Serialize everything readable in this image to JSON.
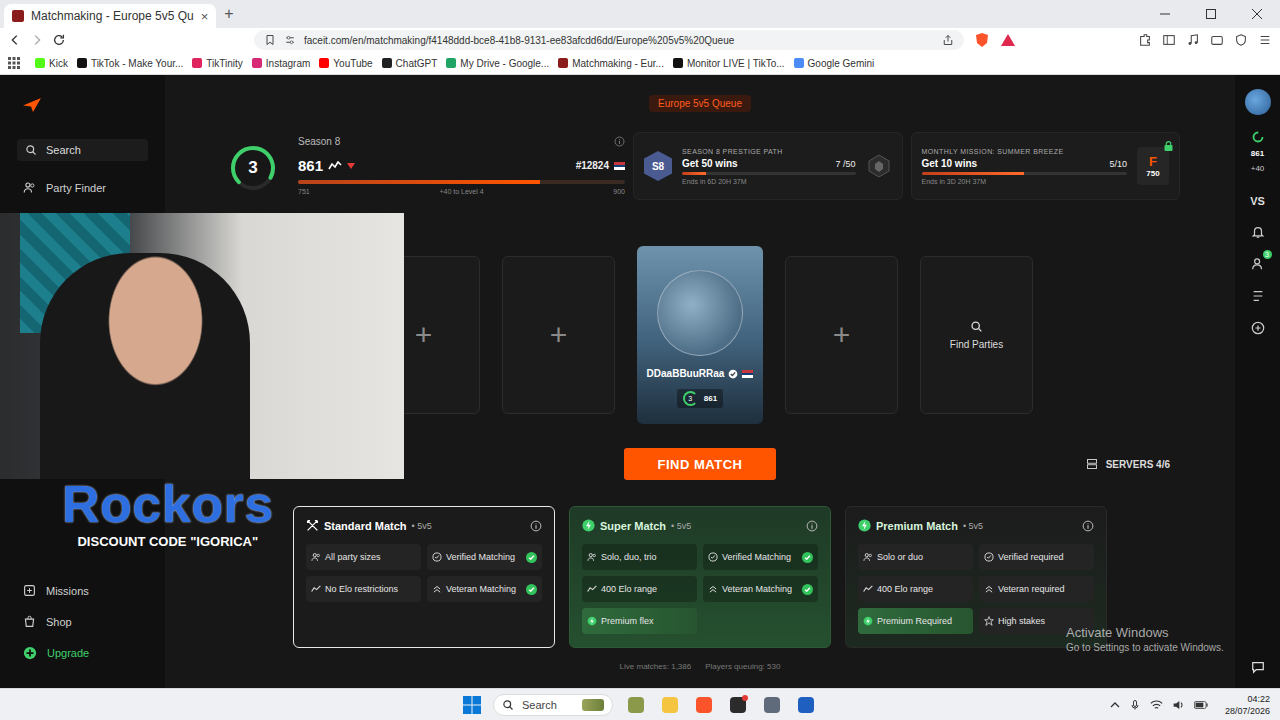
{
  "browser": {
    "tabs": [
      {
        "title": "Matchmaking - Europe 5v5 Qu",
        "selected": true,
        "close": "×"
      }
    ],
    "new_tab": "+",
    "url": "faceit.com/en/matchmaking/f4148ddd-bce8-41b8-9131-ee83afcdd6dd/Europe%205v5%20Queue",
    "bookmarks": [
      {
        "label": "Kick",
        "color": "#53fc18"
      },
      {
        "label": "TikTok - Make Your...",
        "color": "#111111"
      },
      {
        "label": "TikTinity",
        "color": "#e0245e"
      },
      {
        "label": "Instagram",
        "color": "#d62976"
      },
      {
        "label": "YouTube",
        "color": "#ff0000"
      },
      {
        "label": "ChatGPT",
        "color": "#202123"
      },
      {
        "label": "My Drive - Google...",
        "color": "#1fa463"
      },
      {
        "label": "Matchmaking - Eur...",
        "color": "#8a1c1c"
      },
      {
        "label": "Monitor LIVE | TikTo...",
        "color": "#111111"
      },
      {
        "label": "Google Gemini",
        "color": "#4b8bf5"
      }
    ]
  },
  "sidebar": {
    "search": "Search",
    "items": [
      {
        "label": "Party Finder"
      }
    ],
    "bottom_items": [
      {
        "kind": "missions",
        "label": "Missions",
        "color": "#d0d0d0"
      },
      {
        "kind": "shop",
        "label": "Shop",
        "color": "#d0d0d0"
      },
      {
        "kind": "upgrade",
        "label": "Upgrade",
        "color": "#3fcf6b"
      }
    ]
  },
  "queue": {
    "title": "Europe 5v5 Queue"
  },
  "profile": {
    "season": "Season 8",
    "level": "3",
    "ring_level": 0.7,
    "elo": "861",
    "elo_falling": true,
    "rank": "#12824",
    "bar_min": "751",
    "bar_note": "+40 to Level 4",
    "bar_max": "900",
    "bar_level": 0.74
  },
  "missions": [
    {
      "kind": "prestige",
      "badge": "S8",
      "title": "SEASON 8 PRESTIGE PATH",
      "goal": "Get 50 wins",
      "count": "7 /50",
      "ends": "Ends in 6D 20H 37M",
      "level": 0.14
    },
    {
      "kind": "monthly",
      "badge": "F",
      "title": "MONTHLY MISSION: SUMMER BREEZE",
      "goal": "Get 10 wins",
      "count": "5/10",
      "ends": "Ends in 3D 20H 37M",
      "level": 0.5,
      "reward": "750",
      "locked": true
    }
  ],
  "slots": [
    {
      "kind": "empty",
      "icon": "+"
    },
    {
      "kind": "empty",
      "icon": "+"
    },
    {
      "kind": "player",
      "name": "DDaaBBuuRRaa",
      "level": "3",
      "elo": "861",
      "verified": true
    },
    {
      "kind": "empty",
      "icon": "+"
    },
    {
      "kind": "find",
      "label": "Find Parties"
    }
  ],
  "find_button": "FIND MATCH",
  "servers": "SERVERS 4/6",
  "modes": [
    {
      "kind": "standard",
      "name": "Standard Match",
      "format": "• 5v5",
      "selected": true,
      "features": [
        {
          "kind": "party",
          "label": "All party sizes",
          "included": false,
          "highlight": false
        },
        {
          "kind": "verified",
          "label": "Verified Matching",
          "included": true,
          "highlight": false
        },
        {
          "kind": "elo",
          "label": "No Elo restrictions",
          "included": false,
          "highlight": false
        },
        {
          "kind": "veteran",
          "label": "Veteran Matching",
          "included": true,
          "highlight": false
        }
      ]
    },
    {
      "kind": "super",
      "name": "Super Match",
      "format": "• 5v5",
      "selected": false,
      "features": [
        {
          "kind": "party",
          "label": "Solo, duo, trio",
          "included": false,
          "highlight": false
        },
        {
          "kind": "verified",
          "label": "Verified Matching",
          "included": true,
          "highlight": false
        },
        {
          "kind": "elo",
          "label": "400 Elo range",
          "included": false,
          "highlight": false
        },
        {
          "kind": "veteran",
          "label": "Veteran Matching",
          "included": true,
          "highlight": false
        },
        {
          "kind": "premium",
          "label": "Premium flex",
          "included": false,
          "highlight": true
        }
      ]
    },
    {
      "kind": "premium",
      "name": "Premium Match",
      "format": "• 5v5",
      "selected": false,
      "features": [
        {
          "kind": "party",
          "label": "Solo or duo",
          "included": false,
          "highlight": false
        },
        {
          "kind": "verified",
          "label": "Verified required",
          "included": false,
          "highlight": false
        },
        {
          "kind": "elo",
          "label": "400 Elo range",
          "included": false,
          "highlight": false
        },
        {
          "kind": "veteran",
          "label": "Veteran required",
          "included": false,
          "highlight": false
        },
        {
          "kind": "premium",
          "label": "Premium Required",
          "included": false,
          "highlight": true
        },
        {
          "kind": "stakes",
          "label": "High stakes",
          "included": false,
          "highlight": false
        }
      ]
    }
  ],
  "stats": {
    "live": "Live matches: 1,386",
    "queuing": "Players queuing: 530"
  },
  "rail": {
    "elo": "861",
    "elo_change": "+40",
    "vs": "VS",
    "badge": "3"
  },
  "overlay": {
    "brand": "Rockors",
    "discount": "DISCOUNT CODE \"IGORICA\""
  },
  "watermark": {
    "title": "Activate Windows",
    "subtitle": "Go to Settings to activate Windows."
  },
  "taskbar": {
    "search": "Search",
    "time": "04:22",
    "date": "28/07/2026",
    "apps": [
      {
        "color": "#8a9a4a",
        "notification": false
      },
      {
        "color": "#f5c542",
        "notification": false
      },
      {
        "color": "#fb542b",
        "notification": false
      },
      {
        "color": "#2b2b2b",
        "notification": true
      },
      {
        "color": "#5f6b7a",
        "notification": false
      },
      {
        "color": "#1f5fbf",
        "notification": false
      }
    ]
  }
}
